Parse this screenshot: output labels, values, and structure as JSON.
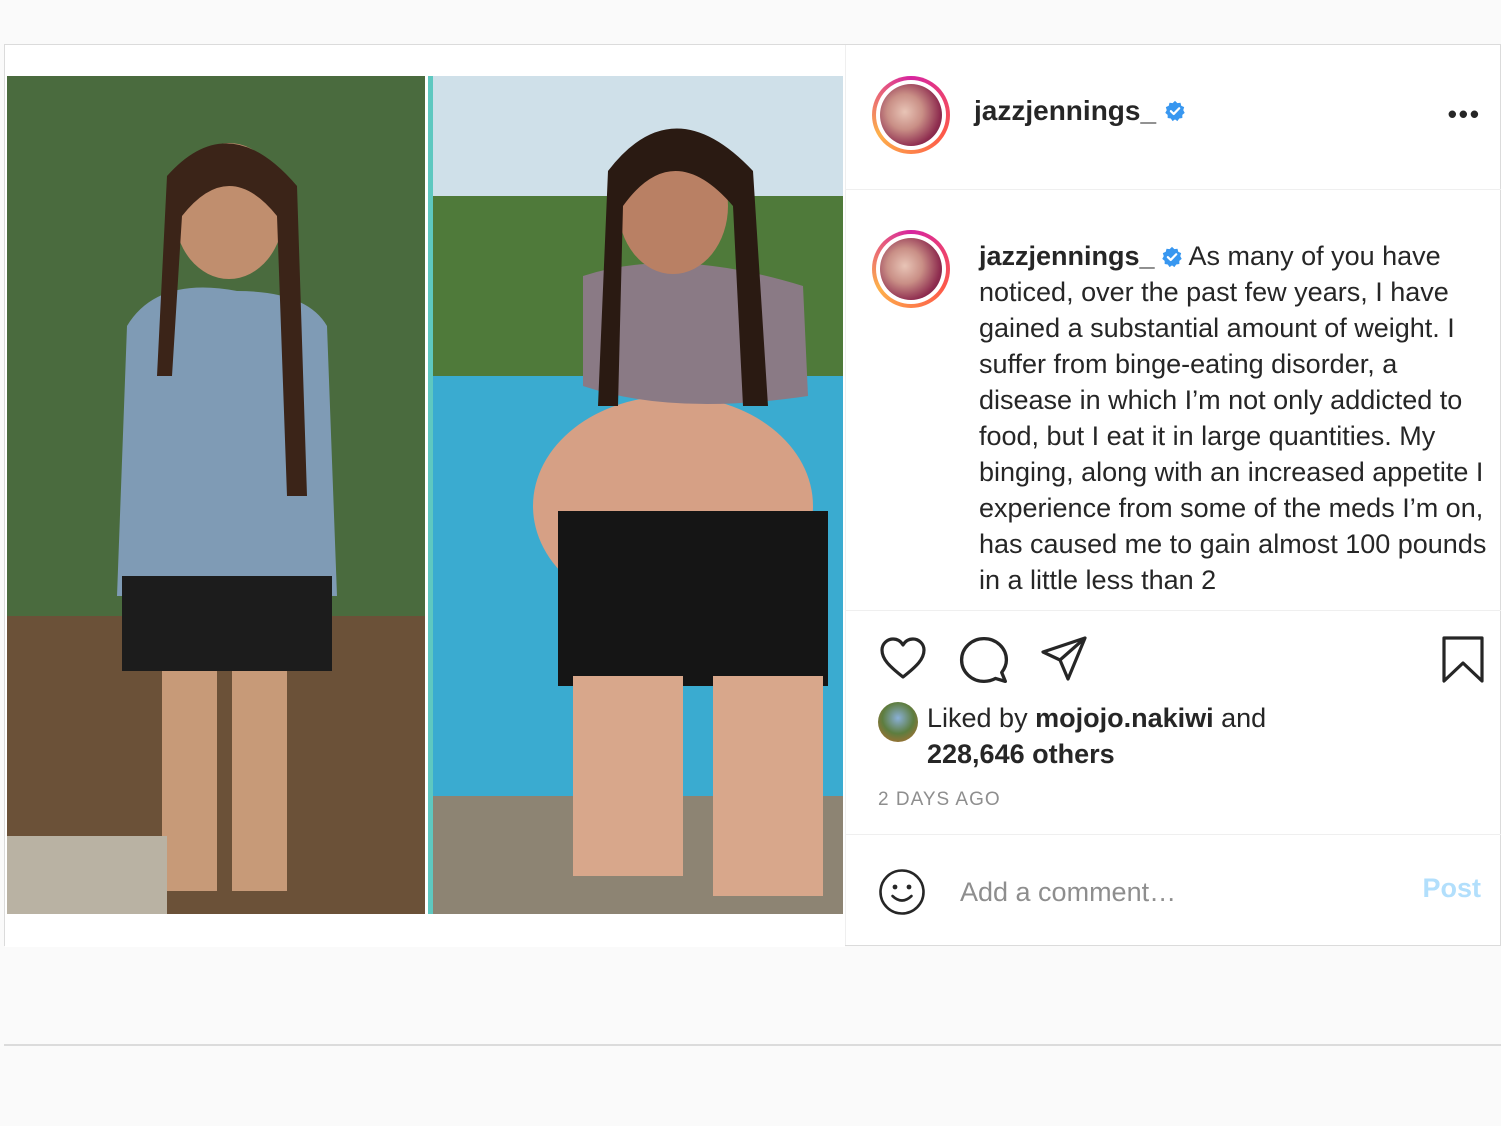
{
  "post": {
    "username": "jazzjennings_",
    "more_label": "•••",
    "caption": "As many of you have noticed, over the past few years, I have gained a substantial amount of weight. I suffer from binge-eating disorder, a disease in which I’m not only addicted to food, but I eat it in large quantities. My binging, along with an increased appetite I experience from some of the meds I’m on, has caused me to gain almost 100 pounds in a little less than 2",
    "liked_by_prefix": "Liked by",
    "liked_by_user": "mojojo.nakiwi",
    "liked_by_and": "and",
    "liked_by_others": "228,646 others",
    "timestamp": "2 DAYS AGO",
    "comment_placeholder": "Add a comment…",
    "post_button": "Post"
  },
  "colors": {
    "verified": "#3897f0",
    "post_button": "#b2dffc",
    "secondary_text": "#8e8e8e"
  },
  "icons": [
    "heart-icon",
    "comment-icon",
    "share-icon",
    "bookmark-icon",
    "emoji-icon",
    "verified-icon",
    "more-icon"
  ]
}
